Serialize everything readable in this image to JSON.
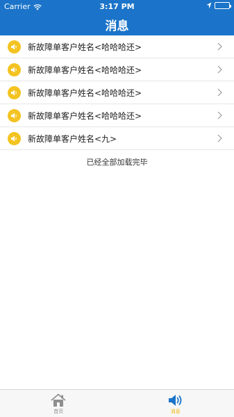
{
  "status_bar": {
    "carrier": "Carrier",
    "time": "3:17 PM"
  },
  "nav": {
    "title": "消息"
  },
  "messages": [
    {
      "text": "新故障单客户姓名<哈哈哈还>"
    },
    {
      "text": "新故障单客户姓名<哈哈哈还>"
    },
    {
      "text": "新故障单客户姓名<哈哈哈还>"
    },
    {
      "text": "新故障单客户姓名<哈哈哈还>"
    },
    {
      "text": "新故障单客户姓名<九>"
    }
  ],
  "load_status": "已经全部加载完毕",
  "tabs": [
    {
      "label": "首页",
      "icon": "home-icon",
      "active": false
    },
    {
      "label": "消息",
      "icon": "speaker-icon",
      "active": true
    }
  ],
  "colors": {
    "primary": "#1b74c9",
    "accent": "#f3c321",
    "active_tab": "#1b74c9"
  }
}
